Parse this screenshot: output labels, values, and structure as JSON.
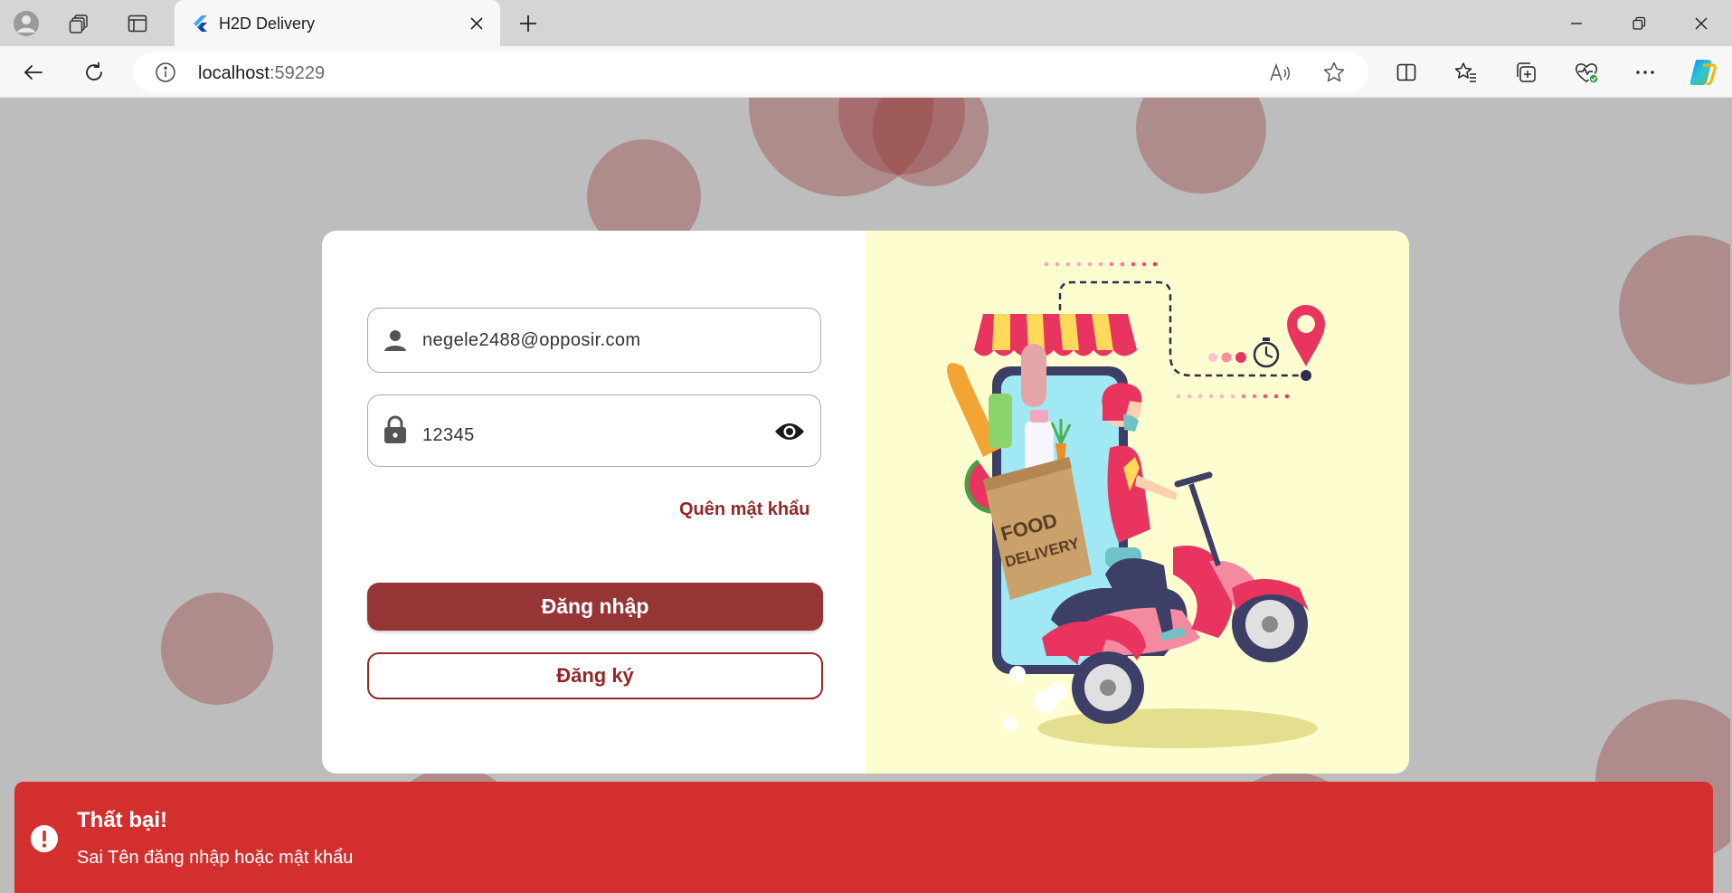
{
  "browser": {
    "tab": {
      "title": "H2D Delivery",
      "favicon": "flutter-icon"
    },
    "address": {
      "host": "localhost",
      "port": ":59229"
    },
    "icons": {
      "profile": "profile-icon",
      "workspaces": "workspaces-icon",
      "tab_actions": "tab-actions-icon",
      "new_tab": "plus-icon",
      "back": "back-arrow-icon",
      "refresh": "refresh-icon",
      "site_info": "info-icon",
      "read_aloud": "read-aloud-icon",
      "favorite": "star-icon",
      "split_screen": "split-screen-icon",
      "favorites": "favorites-icon",
      "collections": "collections-icon",
      "browser_essentials": "heart-pulse-icon",
      "more": "more-icon",
      "copilot": "copilot-icon",
      "minimize": "minimize-icon",
      "restore": "restore-icon",
      "close": "close-icon"
    }
  },
  "login": {
    "email_value": "negele2488@opposir.com",
    "password_value": "12345",
    "forgot_password": "Quên mật khẩu",
    "login_button": "Đăng nhập",
    "register_button": "Đăng ký",
    "illustration_text": [
      "FOOD",
      "DELIVERY"
    ]
  },
  "snackbar": {
    "title": "Thất bại!",
    "message": "Sai Tên đăng nhập hoặc mật khẩu"
  },
  "colors": {
    "primary": "#963535",
    "accent_text": "#962626",
    "error": "#d32f2f",
    "illustration_bg": "#fefdd0",
    "backdrop": "#bdbdbd"
  }
}
